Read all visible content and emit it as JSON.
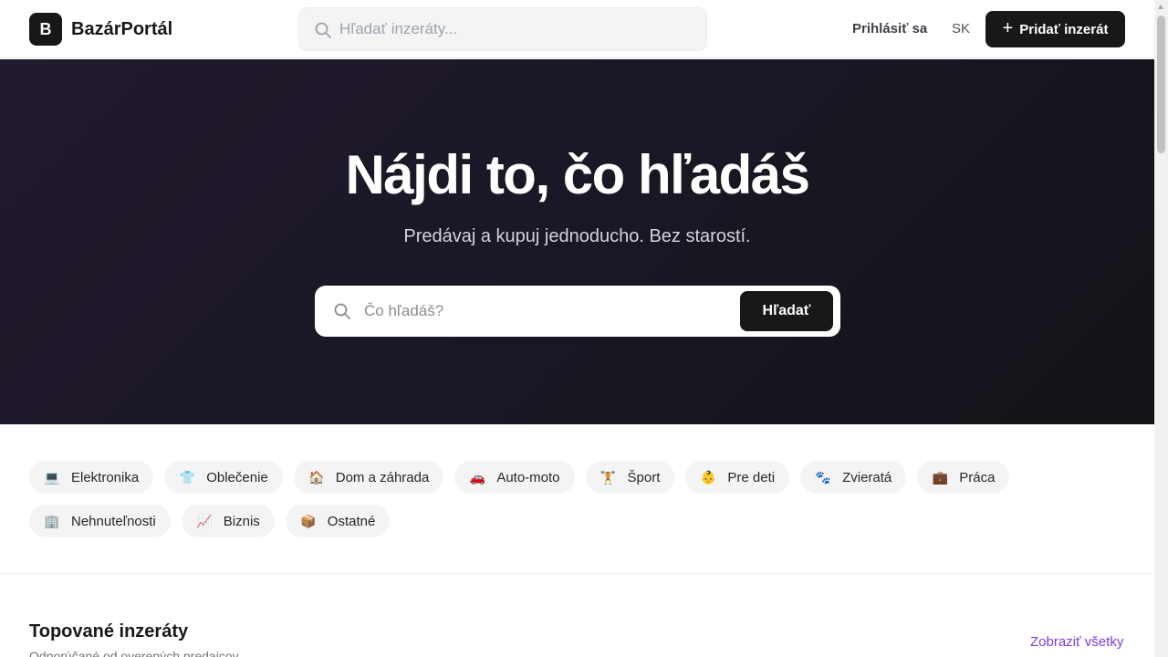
{
  "header": {
    "logo_letter": "B",
    "brand": "BazárPortál",
    "search_placeholder": "Hľadať inzeráty...",
    "login_label": "Prihlásiť sa",
    "language": "SK",
    "add_button_label": "Pridať inzerát"
  },
  "hero": {
    "title": "Nájdi to, čo hľadáš",
    "subtitle": "Predávaj a kupuj jednoducho. Bez starostí.",
    "search_placeholder": "Čo hľadáš?",
    "search_button": "Hľadať"
  },
  "categories": [
    {
      "label": "Elektronika",
      "icon": "💻"
    },
    {
      "label": "Oblečenie",
      "icon": "👕"
    },
    {
      "label": "Dom a záhrada",
      "icon": "🏠"
    },
    {
      "label": "Auto-moto",
      "icon": "🚗"
    },
    {
      "label": "Šport",
      "icon": "🏋"
    },
    {
      "label": "Pre deti",
      "icon": "👶"
    },
    {
      "label": "Zvieratá",
      "icon": "🐾"
    },
    {
      "label": "Práca",
      "icon": "💼"
    },
    {
      "label": "Nehnuteľnosti",
      "icon": "🏢"
    },
    {
      "label": "Biznis",
      "icon": "📈"
    },
    {
      "label": "Ostatné",
      "icon": "📦"
    }
  ],
  "featured": {
    "title": "Topované inzeráty",
    "subtitle": "Odporúčané od overených predajcov",
    "see_all": "Zobraziť všetky"
  },
  "colors": {
    "primary": "#18181b",
    "accent": "#7c3aed",
    "hero_bg": "#1e1a28"
  }
}
